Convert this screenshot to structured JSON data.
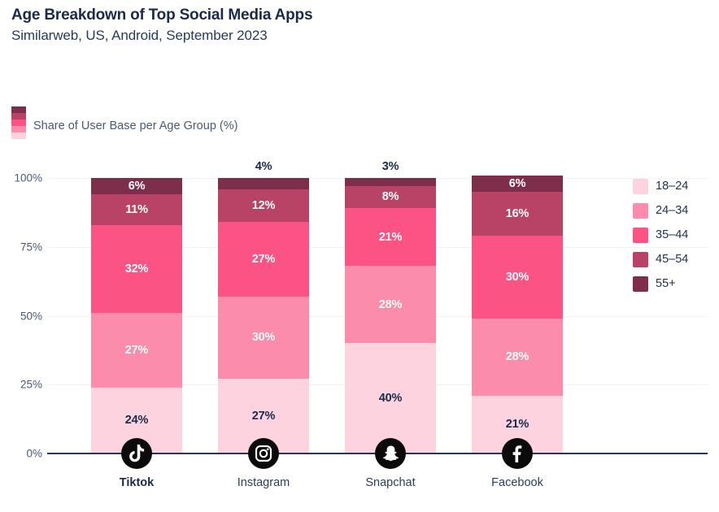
{
  "header": {
    "title": "Age Breakdown of Top Social Media Apps",
    "subtitle": "Similarweb, US, Android, September 2023"
  },
  "axis_key": {
    "label": "Share of User Base per Age Group (%)",
    "swatch_icon": "stacked-color-swatch-icon"
  },
  "legend": {
    "position": "right",
    "items": [
      {
        "label": "18–24",
        "color": "#FCD3DE",
        "swatch_icon": "legend-swatch-icon"
      },
      {
        "label": "24–34",
        "color": "#FB8CAB",
        "swatch_icon": "legend-swatch-icon"
      },
      {
        "label": "35–44",
        "color": "#FB5484",
        "swatch_icon": "legend-swatch-icon"
      },
      {
        "label": "45–54",
        "color": "#B94367",
        "swatch_icon": "legend-swatch-icon"
      },
      {
        "label": "55+",
        "color": "#7C2E4A",
        "swatch_icon": "legend-swatch-icon"
      }
    ]
  },
  "yaxis": {
    "ticks": [
      "0%",
      "25%",
      "50%",
      "75%",
      "100%"
    ],
    "tick_values": [
      0,
      25,
      50,
      75,
      100
    ]
  },
  "categories": [
    {
      "label": "Tiktok",
      "icon": "tiktok-icon",
      "bold": true
    },
    {
      "label": "Instagram",
      "icon": "instagram-icon",
      "bold": false
    },
    {
      "label": "Snapchat",
      "icon": "snapchat-icon",
      "bold": false
    },
    {
      "label": "Facebook",
      "icon": "facebook-icon",
      "bold": false
    }
  ],
  "chart_data": {
    "type": "bar",
    "subtype": "stacked-100-percent",
    "title": "Age Breakdown of Top Social Media Apps",
    "subtitle": "Similarweb, US, Android, September 2023",
    "xlabel": "",
    "ylabel": "Share of User Base per Age Group (%)",
    "ylim": [
      0,
      100
    ],
    "ytick_labels": [
      "0%",
      "25%",
      "50%",
      "75%",
      "100%"
    ],
    "grid": true,
    "legend_position": "right",
    "categories": [
      "Tiktok",
      "Instagram",
      "Snapchat",
      "Facebook"
    ],
    "series": [
      {
        "name": "18–24",
        "color": "#FCD3DE",
        "values": [
          24,
          27,
          40,
          21
        ],
        "labels": [
          "24%",
          "27%",
          "40%",
          "21%"
        ],
        "label_color": "dark",
        "label_placement": [
          "inside",
          "inside",
          "inside",
          "inside"
        ]
      },
      {
        "name": "24–34",
        "color": "#FB8CAB",
        "values": [
          27,
          30,
          28,
          28
        ],
        "labels": [
          "27%",
          "30%",
          "28%",
          "28%"
        ],
        "label_color": "white",
        "label_placement": [
          "inside",
          "inside",
          "inside",
          "inside"
        ]
      },
      {
        "name": "35–44",
        "color": "#FB5484",
        "values": [
          32,
          27,
          21,
          30
        ],
        "labels": [
          "32%",
          "27%",
          "21%",
          "30%"
        ],
        "label_color": "white",
        "label_placement": [
          "inside",
          "inside",
          "inside",
          "inside"
        ]
      },
      {
        "name": "45–54",
        "color": "#B94367",
        "values": [
          11,
          12,
          8,
          16
        ],
        "labels": [
          "11%",
          "12%",
          "8%",
          "16%"
        ],
        "label_color": "white",
        "label_placement": [
          "inside",
          "inside",
          "inside",
          "inside"
        ]
      },
      {
        "name": "55+",
        "color": "#7C2E4A",
        "values": [
          6,
          4,
          3,
          6
        ],
        "labels": [
          "6%",
          "4%",
          "3%",
          "6%"
        ],
        "label_color": "white",
        "label_placement": [
          "inside",
          "above",
          "above",
          "inside"
        ]
      }
    ]
  },
  "colors": {
    "title": "#1b2a4a",
    "subtitle": "#273b5b",
    "axis_line": "#243858",
    "gridline": "#f2f2f4",
    "tick_text": "#4a5a74",
    "icon_circle": "#0b0b0b"
  }
}
